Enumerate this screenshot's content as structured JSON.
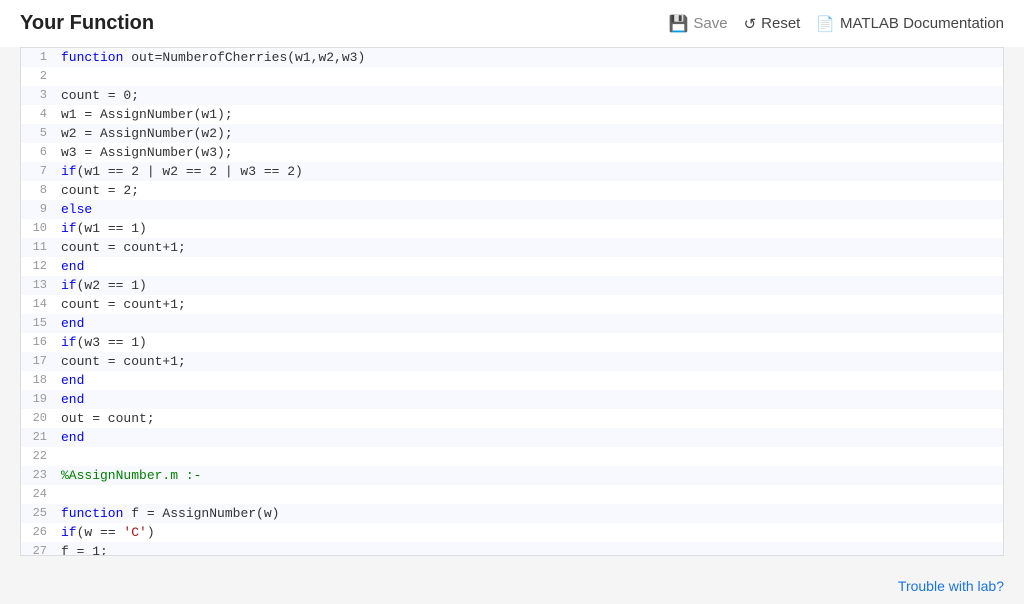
{
  "header": {
    "title": "Your Function",
    "save_label": "Save",
    "reset_label": "Reset",
    "matlab_label": "MATLAB Documentation"
  },
  "footer": {
    "trouble_label": "Trouble with lab?"
  },
  "code_lines": [
    {
      "num": 1,
      "tokens": [
        {
          "type": "kw-blue",
          "text": "function"
        },
        {
          "type": "plain",
          "text": " out=NumberofCherries(w1,w2,w3)"
        }
      ]
    },
    {
      "num": 2,
      "tokens": []
    },
    {
      "num": 3,
      "tokens": [
        {
          "type": "plain",
          "text": "count = 0;"
        }
      ]
    },
    {
      "num": 4,
      "tokens": [
        {
          "type": "plain",
          "text": "w1 = AssignNumber(w1);"
        }
      ]
    },
    {
      "num": 5,
      "tokens": [
        {
          "type": "plain",
          "text": "w2 = AssignNumber(w2);"
        }
      ]
    },
    {
      "num": 6,
      "tokens": [
        {
          "type": "plain",
          "text": "w3 = AssignNumber(w3);"
        }
      ]
    },
    {
      "num": 7,
      "tokens": [
        {
          "type": "kw-blue",
          "text": "if"
        },
        {
          "type": "plain",
          "text": "(w1 == 2 | w2 == 2 | w3 == 2)"
        }
      ]
    },
    {
      "num": 8,
      "tokens": [
        {
          "type": "plain",
          "text": "count = 2;"
        }
      ]
    },
    {
      "num": 9,
      "tokens": [
        {
          "type": "kw-blue",
          "text": "else"
        }
      ]
    },
    {
      "num": 10,
      "tokens": [
        {
          "type": "kw-blue",
          "text": "if"
        },
        {
          "type": "plain",
          "text": "(w1 == 1)"
        }
      ]
    },
    {
      "num": 11,
      "tokens": [
        {
          "type": "plain",
          "text": "count = count+1;"
        }
      ]
    },
    {
      "num": 12,
      "tokens": [
        {
          "type": "kw-blue",
          "text": "end"
        }
      ]
    },
    {
      "num": 13,
      "tokens": [
        {
          "type": "kw-blue",
          "text": "if"
        },
        {
          "type": "plain",
          "text": "(w2 == 1)"
        }
      ]
    },
    {
      "num": 14,
      "tokens": [
        {
          "type": "plain",
          "text": "count = count+1;"
        }
      ]
    },
    {
      "num": 15,
      "tokens": [
        {
          "type": "kw-blue",
          "text": "end"
        }
      ]
    },
    {
      "num": 16,
      "tokens": [
        {
          "type": "kw-blue",
          "text": "if"
        },
        {
          "type": "plain",
          "text": "(w3 == 1)"
        }
      ]
    },
    {
      "num": 17,
      "tokens": [
        {
          "type": "plain",
          "text": "count = count+1;"
        }
      ]
    },
    {
      "num": 18,
      "tokens": [
        {
          "type": "kw-blue",
          "text": "end"
        }
      ]
    },
    {
      "num": 19,
      "tokens": [
        {
          "type": "kw-blue",
          "text": "end"
        }
      ]
    },
    {
      "num": 20,
      "tokens": [
        {
          "type": "plain",
          "text": "out = count;"
        }
      ]
    },
    {
      "num": 21,
      "tokens": [
        {
          "type": "kw-blue",
          "text": "end"
        }
      ]
    },
    {
      "num": 22,
      "tokens": []
    },
    {
      "num": 23,
      "tokens": [
        {
          "type": "kw-green",
          "text": "%AssignNumber.m :-"
        }
      ]
    },
    {
      "num": 24,
      "tokens": []
    },
    {
      "num": 25,
      "tokens": [
        {
          "type": "kw-blue",
          "text": "function"
        },
        {
          "type": "plain",
          "text": " f = AssignNumber(w)"
        }
      ]
    },
    {
      "num": 26,
      "tokens": [
        {
          "type": "kw-blue",
          "text": "if"
        },
        {
          "type": "plain",
          "text": "(w == "
        },
        {
          "type": "str-char",
          "text": "'C'"
        },
        {
          "type": "plain",
          "text": ")"
        }
      ]
    },
    {
      "num": 27,
      "tokens": [
        {
          "type": "plain",
          "text": "f = 1;"
        }
      ]
    }
  ]
}
